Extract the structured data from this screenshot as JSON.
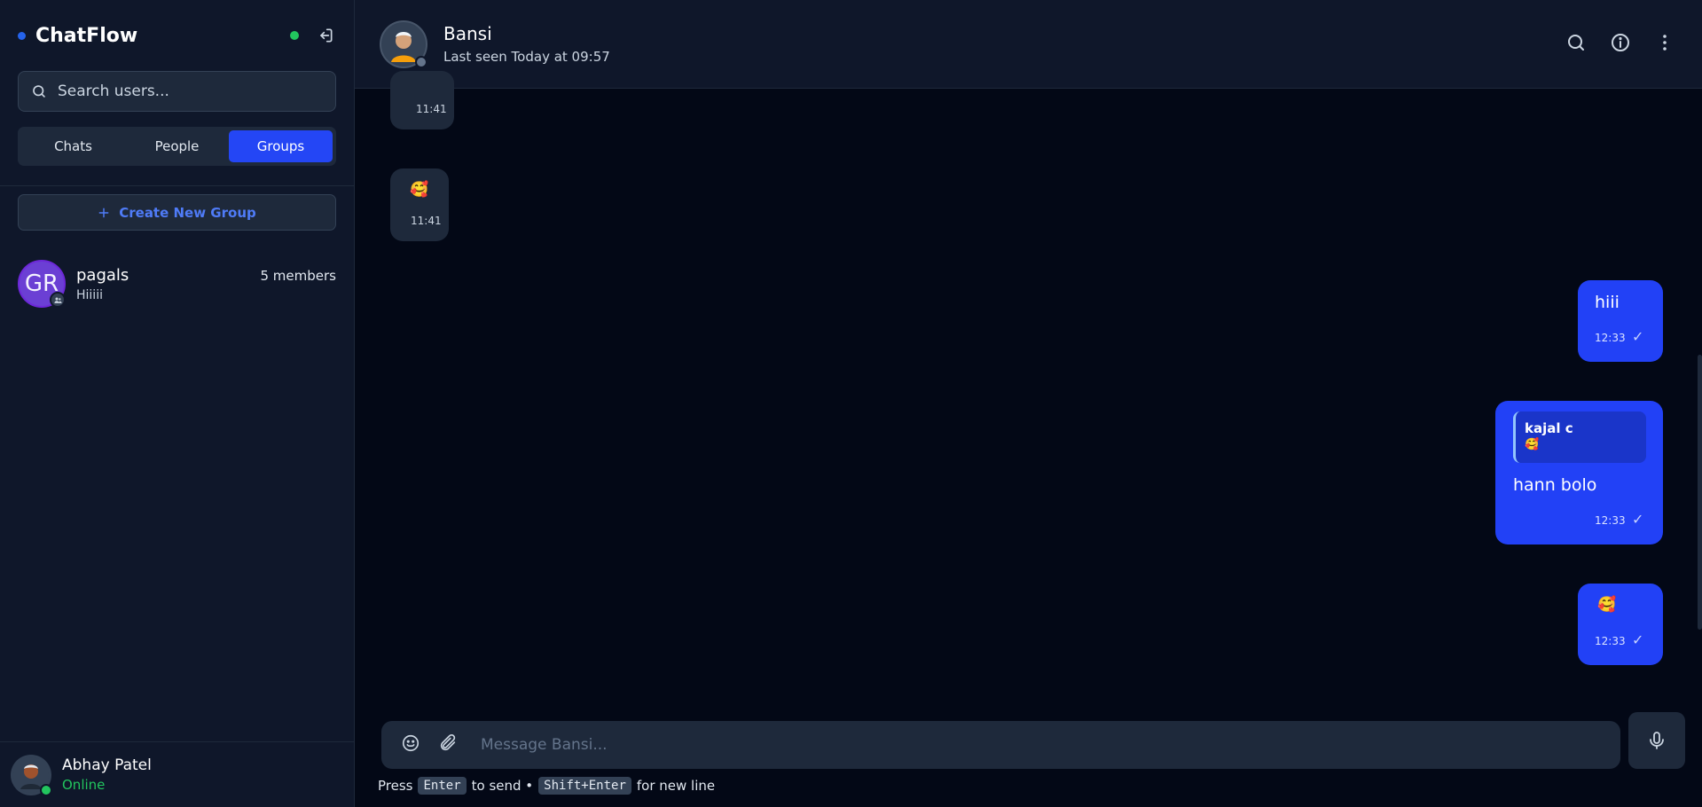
{
  "sidebar": {
    "brand": "ChatFlow",
    "search": {
      "placeholder": "Search users..."
    },
    "tabs": [
      {
        "label": "Chats",
        "active": false
      },
      {
        "label": "People",
        "active": false
      },
      {
        "label": "Groups",
        "active": true
      }
    ],
    "create_group_label": "Create New Group",
    "groups": [
      {
        "initials": "GR",
        "name": "pagals",
        "members": "5 members",
        "last_message": "Hiiiii"
      }
    ],
    "current_user": {
      "name": "Abhay Patel",
      "status": "Online"
    }
  },
  "chat": {
    "name": "Bansi",
    "last_seen": "Last seen Today at 09:57"
  },
  "messages": [
    {
      "direction": "in",
      "time": "11:41"
    },
    {
      "direction": "in",
      "emoji": "🥰",
      "time": "11:41"
    },
    {
      "direction": "out",
      "text": "hiii",
      "time": "12:33"
    },
    {
      "direction": "out",
      "reply_to": {
        "name": "kajal c",
        "emoji": "🥰"
      },
      "text": "hann bolo",
      "time": "12:33"
    },
    {
      "direction": "out",
      "emoji": "🥰",
      "time": "12:33"
    }
  ],
  "composer": {
    "placeholder": "Message Bansi...",
    "hint_press": "Press",
    "hint_key1": "Enter",
    "hint_send": "to send •",
    "hint_key2": "Shift+Enter",
    "hint_newline": "for new line"
  },
  "colors": {
    "accent": "#2241f6",
    "online": "#22c55e",
    "sidebar_bg": "#0f172a",
    "chat_bg": "#030816"
  }
}
